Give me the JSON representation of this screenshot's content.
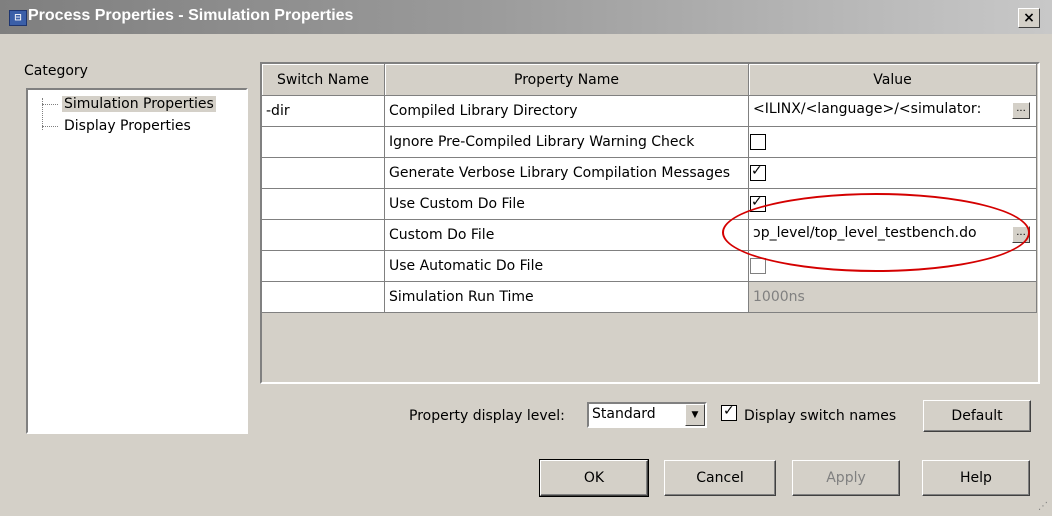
{
  "window": {
    "icon": "properties-app-icon",
    "icon_text": "⊟",
    "title": "Process Properties - Simulation Properties",
    "close_label": "×"
  },
  "category": {
    "label": "Category",
    "items": [
      {
        "label": "Simulation Properties",
        "selected": true
      },
      {
        "label": "Display Properties",
        "selected": false
      }
    ]
  },
  "grid": {
    "headers": [
      "Switch Name",
      "Property Name",
      "Value"
    ],
    "rows": [
      {
        "switch": "-dir",
        "name": "Compiled Library Directory",
        "value": ":ILINX/<language>/<simulator>",
        "type": "text-browse"
      },
      {
        "switch": "",
        "name": "Ignore Pre-Compiled Library Warning Check",
        "value": "",
        "type": "checkbox",
        "checked": false
      },
      {
        "switch": "",
        "name": "Generate Verbose Library Compilation Messages",
        "value": "",
        "type": "checkbox",
        "checked": true
      },
      {
        "switch": "",
        "name": "Use Custom Do File",
        "value": "",
        "type": "checkbox",
        "checked": true
      },
      {
        "switch": "",
        "name": "Custom Do File",
        "value": "ɔp_level/top_level_testbench.do",
        "type": "text-browse"
      },
      {
        "switch": "",
        "name": "Use Automatic Do File",
        "value": "",
        "type": "checkbox",
        "checked": false,
        "disabled": true
      },
      {
        "switch": "",
        "name": "Simulation Run Time",
        "value": "1000ns",
        "type": "text-disabled"
      }
    ],
    "browse_label": "..."
  },
  "footer": {
    "property_display_level_label": "Property display level:",
    "property_display_level_value": "Standard",
    "display_switch_names_label": "Display switch names",
    "display_switch_names_checked": true,
    "default_label": "Default"
  },
  "buttons": {
    "ok": "OK",
    "cancel": "Cancel",
    "apply": "Apply",
    "help": "Help"
  },
  "colors": {
    "dialog_bg": "#d4d0c8",
    "annotation": "#d40000"
  }
}
